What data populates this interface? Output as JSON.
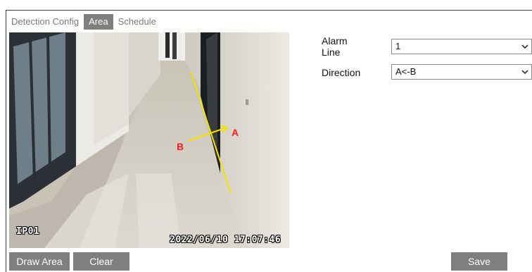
{
  "tabs": [
    {
      "label": "Detection Config",
      "active": false
    },
    {
      "label": "Area",
      "active": true
    },
    {
      "label": "Schedule",
      "active": false
    }
  ],
  "video": {
    "camera_label": "IP01",
    "timestamp": "2022/06/10 17:07:46",
    "line_point_a": "A",
    "line_point_b": "B",
    "line_color": "#f2e400",
    "label_color": "#ff1a1a"
  },
  "form": {
    "alarm_line_label": "Alarm\nLine",
    "alarm_line_value": "1",
    "direction_label": "Direction",
    "direction_value": "A<-B"
  },
  "buttons": {
    "draw_area": "Draw Area",
    "clear": "Clear",
    "save": "Save"
  },
  "icons": {
    "dropdown": "chevron-down-icon"
  }
}
